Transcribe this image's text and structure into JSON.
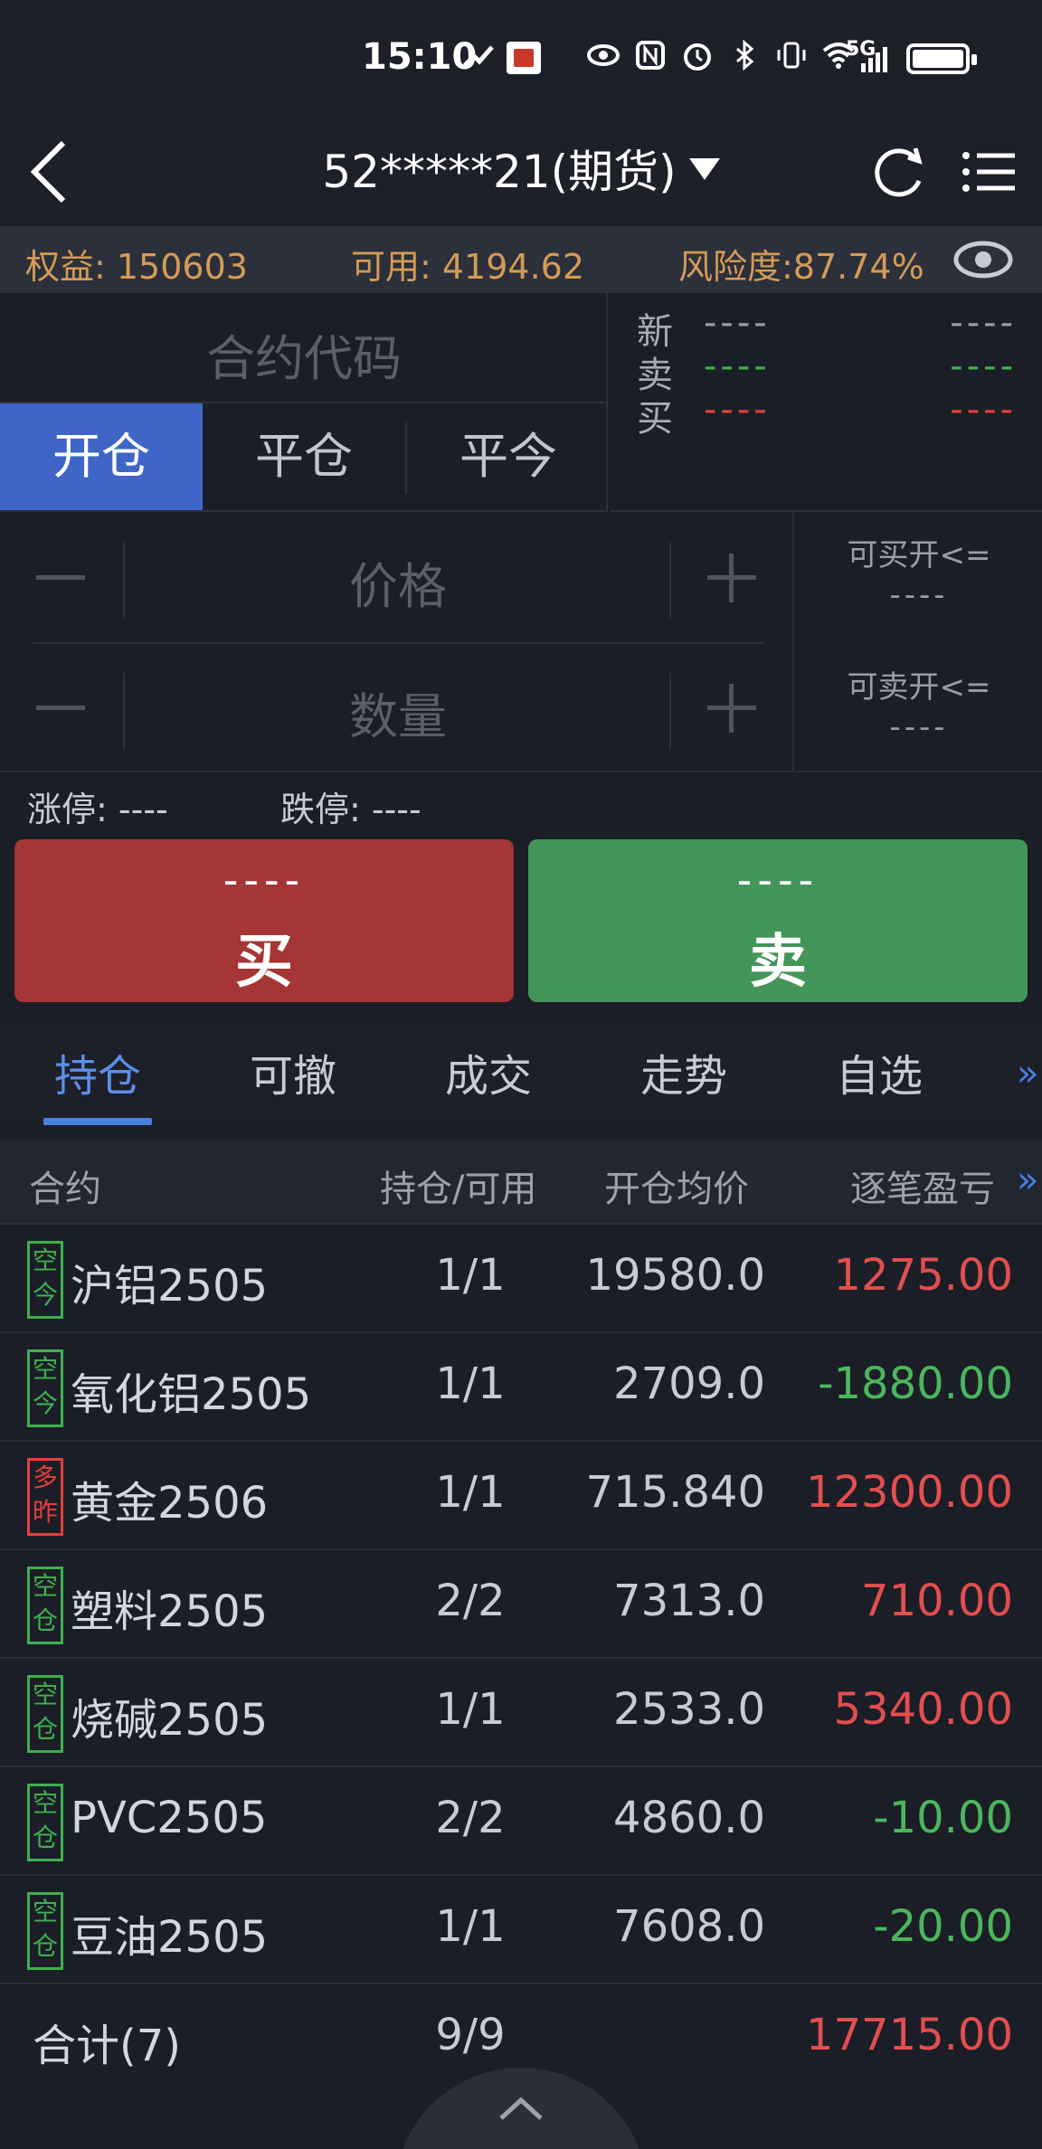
{
  "status": {
    "time": "15:10",
    "network": "5G",
    "icons": [
      "signal-slash-icon",
      "eye-icon",
      "nfc-icon",
      "alarm-icon",
      "bluetooth-icon",
      "vibrate-icon",
      "wifi-icon",
      "signal-icon",
      "battery-charging-icon"
    ]
  },
  "nav": {
    "account": "52*****21(期货)"
  },
  "account_bar": {
    "equity": "权益: 150603",
    "available": "可用: 4194.62",
    "risk": "风险度:87.74%"
  },
  "order": {
    "code_placeholder": "合约代码",
    "tabs": [
      "开仓",
      "平仓",
      "平今"
    ],
    "quote": [
      {
        "label": "新",
        "bid": "----",
        "ask": "----",
        "color": "#9a9da5"
      },
      {
        "label": "卖",
        "bid": "----",
        "ask": "----",
        "color": "#3fae4f"
      },
      {
        "label": "买",
        "bid": "----",
        "ask": "----",
        "color": "#e2403b"
      }
    ],
    "price_placeholder": "价格",
    "qty_placeholder": "数量",
    "can_buy_label": "可买开<=",
    "can_buy_value": "----",
    "can_sell_label": "可卖开<=",
    "can_sell_value": "----",
    "limit_up": "涨停: ----",
    "limit_down": "跌停: ----",
    "buy_price": "----",
    "buy_label": "买",
    "sell_price": "----",
    "sell_label": "卖"
  },
  "tabs": [
    "持仓",
    "可撤",
    "成交",
    "走势",
    "自选"
  ],
  "tab_more": "»",
  "table": {
    "headers": {
      "contract": "合约",
      "position": "持仓/可用",
      "avg": "开仓均价",
      "pnl": "逐笔盈亏",
      "more": "»"
    },
    "rows": [
      {
        "tag": [
          "空",
          "今"
        ],
        "tag_color": "green",
        "name": "沪铝2505",
        "pos": "1/1",
        "avg": "19580.0",
        "pnl": "1275.00",
        "sign": "pos"
      },
      {
        "tag": [
          "空",
          "今"
        ],
        "tag_color": "green",
        "name": "氧化铝2505",
        "pos": "1/1",
        "avg": "2709.0",
        "pnl": "-1880.00",
        "sign": "neg"
      },
      {
        "tag": [
          "多",
          "昨"
        ],
        "tag_color": "red",
        "name": "黄金2506",
        "pos": "1/1",
        "avg": "715.840",
        "pnl": "12300.00",
        "sign": "pos"
      },
      {
        "tag": [
          "空",
          "仓"
        ],
        "tag_color": "green",
        "name": "塑料2505",
        "pos": "2/2",
        "avg": "7313.0",
        "pnl": "710.00",
        "sign": "pos"
      },
      {
        "tag": [
          "空",
          "仓"
        ],
        "tag_color": "green",
        "name": "烧碱2505",
        "pos": "1/1",
        "avg": "2533.0",
        "pnl": "5340.00",
        "sign": "pos"
      },
      {
        "tag": [
          "空",
          "仓"
        ],
        "tag_color": "green",
        "name": "PVC2505",
        "pos": "2/2",
        "avg": "4860.0",
        "pnl": "-10.00",
        "sign": "neg"
      },
      {
        "tag": [
          "空",
          "仓"
        ],
        "tag_color": "green",
        "name": "豆油2505",
        "pos": "1/1",
        "avg": "7608.0",
        "pnl": "-20.00",
        "sign": "neg"
      }
    ],
    "total": {
      "name": "合计(7)",
      "pos": "9/9",
      "pnl": "17715.00"
    }
  }
}
